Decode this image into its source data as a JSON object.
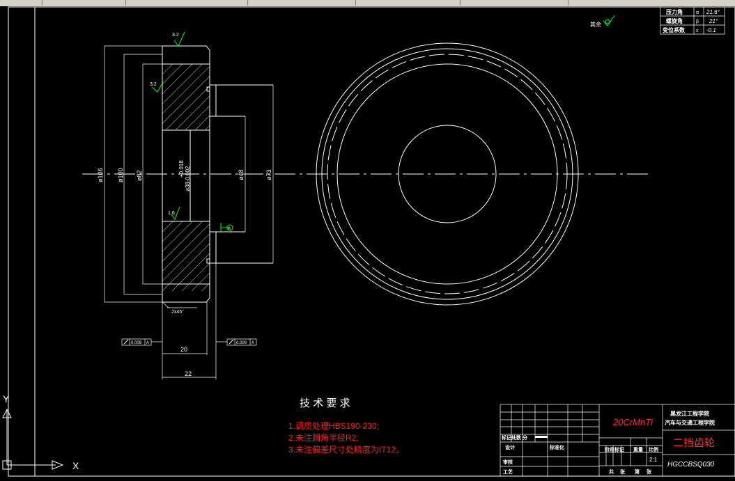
{
  "toolbar": {
    "segments": 8
  },
  "drawing": {
    "surface_roughness": {
      "top": "3.2",
      "left": "3.2",
      "bore": "1.6",
      "other": "其余"
    },
    "dimensions": {
      "d_outer": "ø106",
      "d_100": "ø100",
      "d_82": "ø82",
      "bore_tol": "+0.018",
      "bore_tol2": "ø38-0.002",
      "d_48": "ø48",
      "d_73": "ø73",
      "chamfer": "2x45°",
      "width_20": "20",
      "width_22": "22",
      "runout_left": "0.009",
      "runout_right": "0.009",
      "datum": "A"
    },
    "gear_params": {
      "rows": [
        {
          "label": "压力角",
          "sym": "α",
          "value": "21.6°"
        },
        {
          "label": "螺旋角",
          "sym": "β",
          "value": "21°"
        },
        {
          "label": "变位系数",
          "sym": "x",
          "value": "-0.1"
        }
      ]
    },
    "tech_req": {
      "title": "技 术 要 求",
      "items": [
        "1.调质处理HBS190-230;",
        "2.未注圆角半径R2;",
        "3.未注偏差尺寸处精度为IT12。"
      ]
    },
    "title_block": {
      "material": "20CrMnTi",
      "school": "黑龙江工程学院",
      "dept": "汽车与交通工程学院",
      "part_name": "二挡齿轮",
      "drawing_no": "HGCCBSQ030",
      "scale": "2:1",
      "label_mark": "标记处数 分",
      "label_design": "设计",
      "label_standard": "标准化",
      "label_review": "审核",
      "label_process": "工艺",
      "label_stage": "阶段标记",
      "label_weight": "重量",
      "label_scale": "比例",
      "label_total": "共",
      "label_sheet": "张",
      "label_no": "第",
      "label_page": "张"
    },
    "ucs": {
      "x": "X",
      "y": "Y"
    }
  }
}
